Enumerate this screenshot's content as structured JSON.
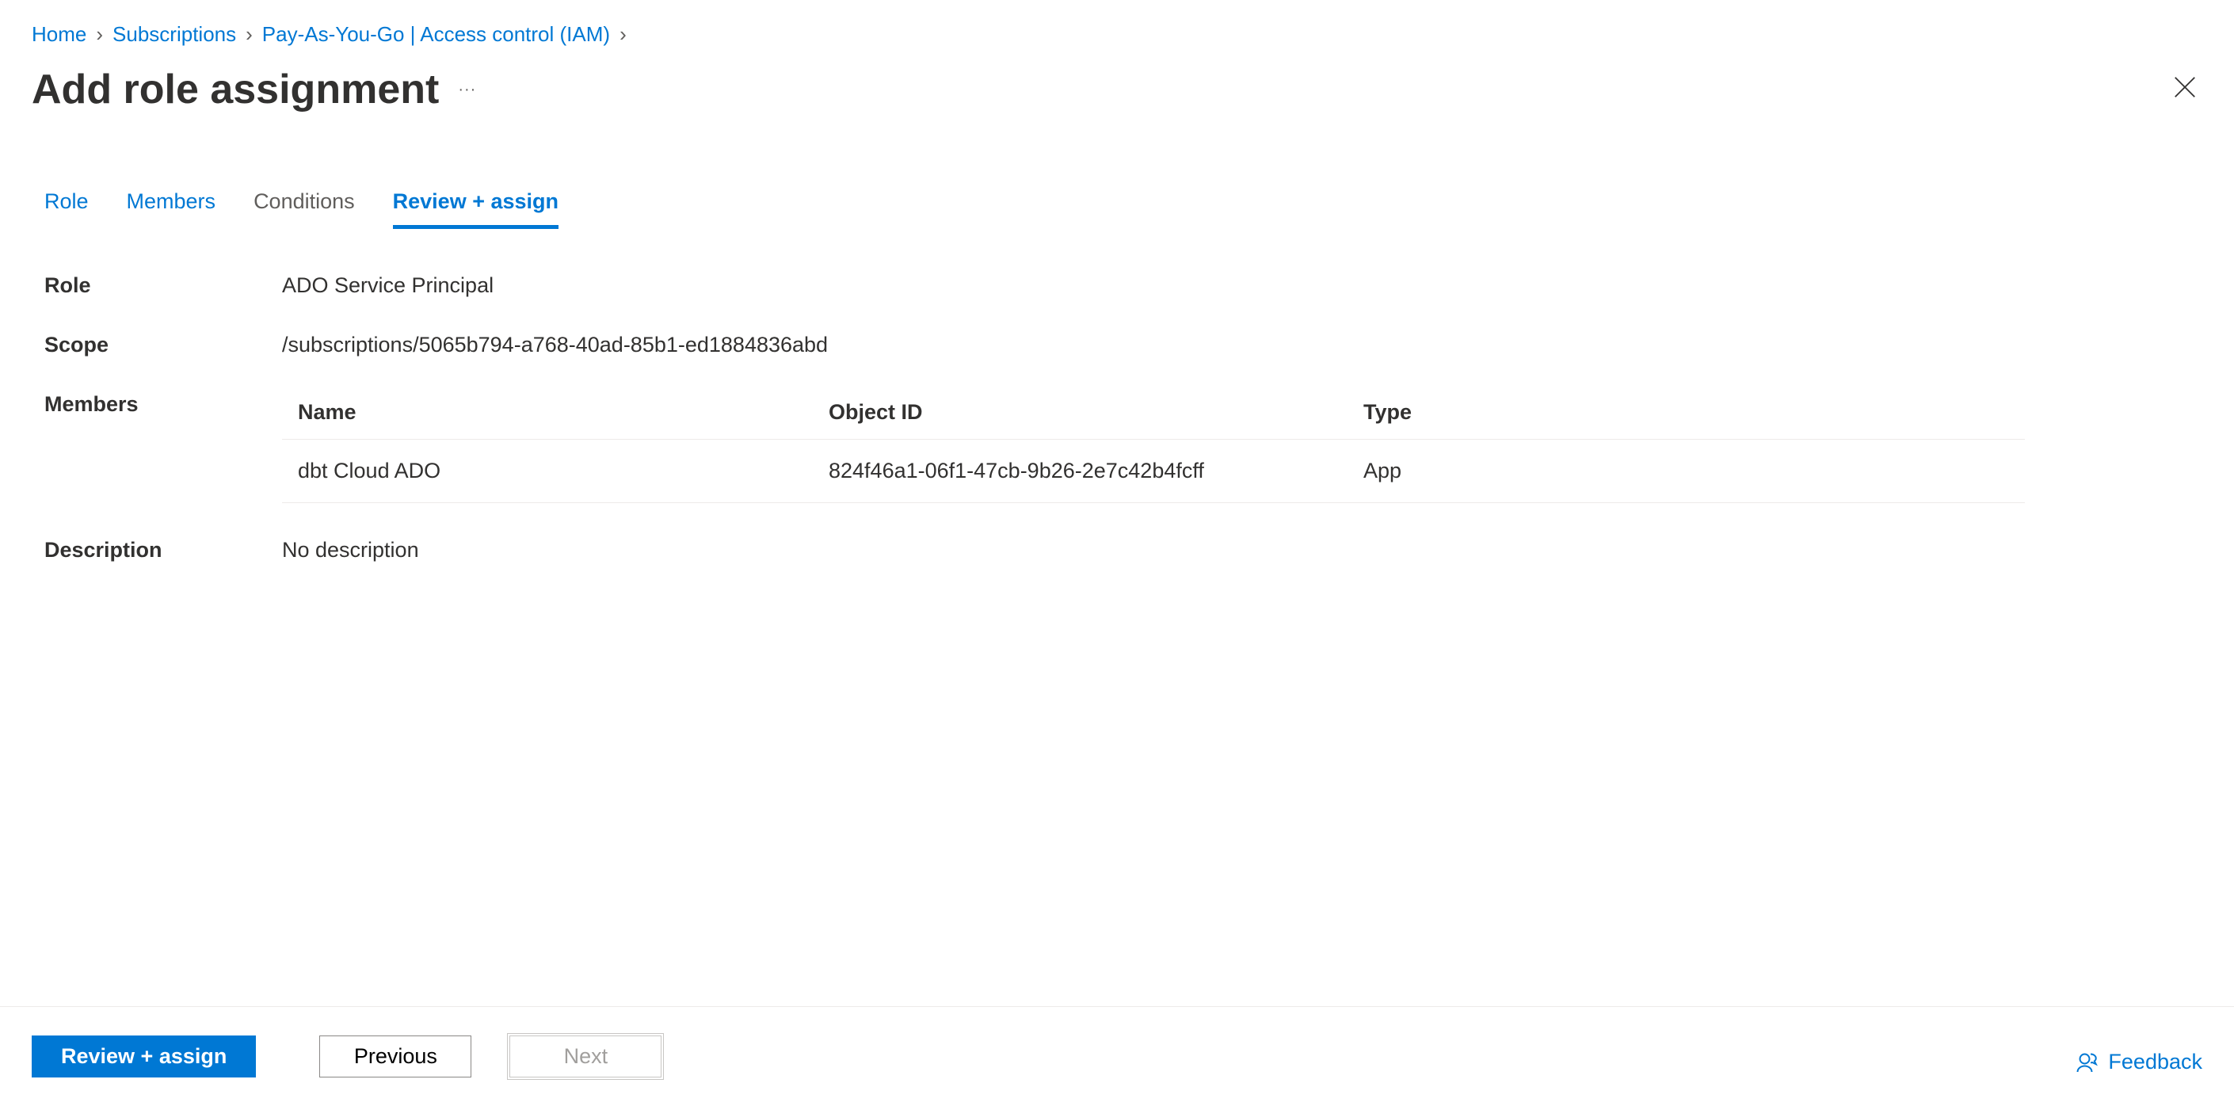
{
  "breadcrumb": [
    {
      "label": "Home"
    },
    {
      "label": "Subscriptions"
    },
    {
      "label": "Pay-As-You-Go | Access control (IAM)"
    }
  ],
  "page_title": "Add role assignment",
  "tabs": {
    "role": "Role",
    "members": "Members",
    "conditions": "Conditions",
    "review_assign": "Review + assign"
  },
  "fields": {
    "role_label": "Role",
    "role_value": "ADO Service Principal",
    "scope_label": "Scope",
    "scope_value": "/subscriptions/5065b794-a768-40ad-85b1-ed1884836abd",
    "members_label": "Members",
    "description_label": "Description",
    "description_value": "No description"
  },
  "members_table": {
    "headers": {
      "name": "Name",
      "object_id": "Object ID",
      "type": "Type"
    },
    "rows": [
      {
        "name": "dbt Cloud ADO",
        "object_id": "824f46a1-06f1-47cb-9b26-2e7c42b4fcff",
        "type": "App"
      }
    ]
  },
  "footer": {
    "review_assign": "Review + assign",
    "previous": "Previous",
    "next": "Next",
    "feedback": "Feedback"
  }
}
